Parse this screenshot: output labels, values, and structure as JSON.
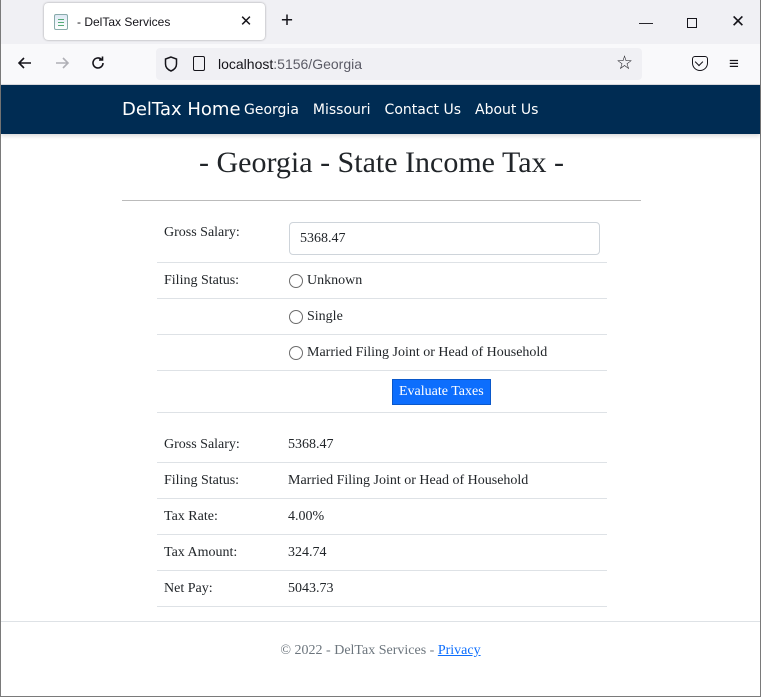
{
  "browser": {
    "tab_title": "- DelTax Services",
    "tab_close": "✕",
    "new_tab": "+",
    "url_host": "localhost",
    "url_path": ":5156/Georgia",
    "win_minimize": "—",
    "win_close": "✕"
  },
  "site_nav": {
    "brand": "DelTax Home",
    "links": [
      "Georgia",
      "Missouri",
      "Contact Us",
      "About Us"
    ]
  },
  "page": {
    "heading": "- Georgia - State Income Tax -"
  },
  "form": {
    "gross_salary_label": "Gross Salary:",
    "gross_salary_value": "5368.47",
    "filing_status_label": "Filing Status:",
    "filing_options": [
      "Unknown",
      "Single",
      "Married Filing Joint or Head of Household"
    ],
    "evaluate_button": "Evaluate Taxes"
  },
  "results": {
    "rows": [
      {
        "label": "Gross Salary:",
        "value": "5368.47"
      },
      {
        "label": "Filing Status:",
        "value": "Married Filing Joint or Head of Household"
      },
      {
        "label": "Tax Rate:",
        "value": "4.00%"
      },
      {
        "label": "Tax Amount:",
        "value": "324.74"
      },
      {
        "label": "Net Pay:",
        "value": "5043.73"
      }
    ]
  },
  "footer": {
    "text": "© 2022 - DelTax Services - ",
    "privacy_link": "Privacy"
  },
  "icons": {
    "back": "arrow-left-icon",
    "forward": "arrow-right-icon",
    "reload": "reload-icon",
    "shield": "shield-icon",
    "bookmark": "star-icon",
    "pocket": "pocket-icon",
    "menu": "hamburger-menu-icon"
  }
}
